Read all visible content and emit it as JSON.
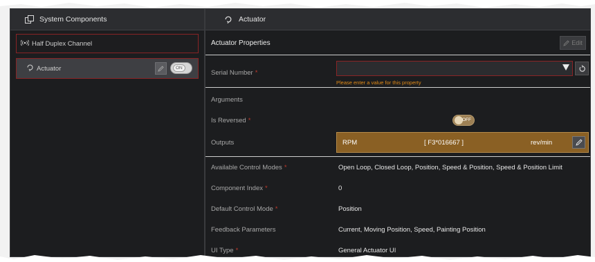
{
  "left_panel": {
    "title": "System Components",
    "title_icon": "components-icon",
    "items": [
      {
        "label": "Half Duplex Channel",
        "icon": "radio-signal-icon",
        "selected": false
      },
      {
        "label": "Actuator",
        "icon": "actuator-icon",
        "selected": true,
        "toggle_label": "ON"
      }
    ]
  },
  "right_panel": {
    "title": "Actuator",
    "title_icon": "actuator-icon",
    "section_title": "Actuator Properties",
    "edit_label": "Edit",
    "required_marker": "*",
    "serial_number": {
      "label": "Serial Number",
      "value": "",
      "error": "Please enter a value for this property"
    },
    "arguments_label": "Arguments",
    "is_reversed": {
      "label": "Is Reversed",
      "toggle_label": "OFF"
    },
    "outputs": {
      "label": "Outputs",
      "name": "RPM",
      "factor": "[ F3*016667 ]",
      "unit": "rev/min"
    },
    "properties": [
      {
        "label": "Available Control Modes",
        "value": "Open Loop, Closed Loop, Position, Speed & Position, Speed & Position Limit",
        "required": true
      },
      {
        "label": "Component Index",
        "value": "0",
        "required": true
      },
      {
        "label": "Default Control Mode",
        "value": "Position",
        "required": true
      },
      {
        "label": "Feedback Parameters",
        "value": "Current, Moving Position, Speed, Painting Position",
        "required": false
      },
      {
        "label": "UI Type",
        "value": "General Actuator UI",
        "required": true
      }
    ]
  },
  "colors": {
    "panel_bg": "#1c1d1f",
    "header_bg": "#2c2d30",
    "required": "#c0392b",
    "error_text": "#e08a17",
    "outputs_bg": "#8a6024",
    "selection_border": "#8a2426"
  }
}
